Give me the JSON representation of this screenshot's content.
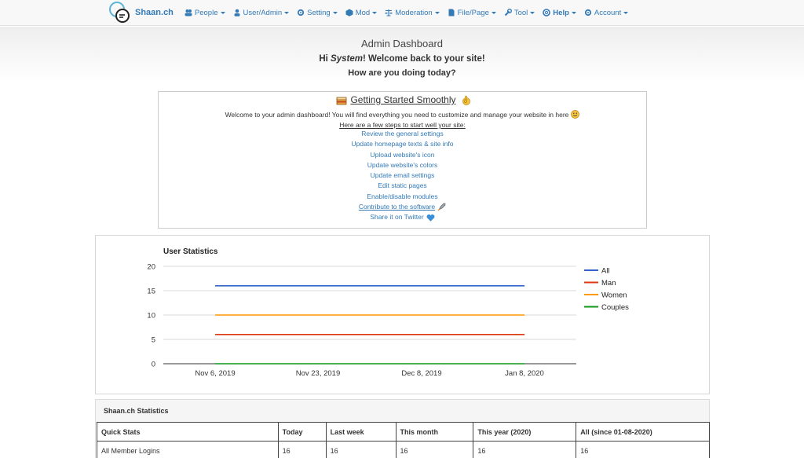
{
  "nav": {
    "brand": "Shaan.ch",
    "items": [
      {
        "label": "People",
        "icon": "users-icon",
        "bold": false
      },
      {
        "label": "User/Admin",
        "icon": "user-icon",
        "bold": false
      },
      {
        "label": "Setting",
        "icon": "gear-icon",
        "bold": false
      },
      {
        "label": "Mod",
        "icon": "cube-icon",
        "bold": false
      },
      {
        "label": "Moderation",
        "icon": "balance-icon",
        "bold": false
      },
      {
        "label": "File/Page",
        "icon": "file-icon",
        "bold": false
      },
      {
        "label": "Tool",
        "icon": "wrench-icon",
        "bold": false
      },
      {
        "label": "Help",
        "icon": "lifebuoy-icon",
        "bold": true
      },
      {
        "label": "Account",
        "icon": "cogs-icon",
        "bold": false
      }
    ]
  },
  "hero": {
    "title": "Admin Dashboard",
    "greeting_prefix": "Hi ",
    "greeting_name": "System",
    "greeting_suffix": "! Welcome back to your site!",
    "question": "How are you doing today?"
  },
  "getting_started": {
    "title": "Getting Started Smoothly",
    "intro": "Welcome to your admin dashboard! You will find everything you need to customize and manage your website in here",
    "steps_title": "Here are a few steps to start well your site:",
    "steps": [
      "Review the general settings",
      "Update homepage texts & site info",
      "Upload website's icon",
      "Update website's colors",
      "Update email settings",
      "Edit static pages",
      "Enable/disable modules",
      "Contribute to the software",
      "Share it on Twitter"
    ]
  },
  "chart_data": {
    "type": "line",
    "title": "User Statistics",
    "xlabel": "",
    "ylabel": "",
    "x": [
      "Nov 6, 2019",
      "Nov 23, 2019",
      "Dec 8, 2019",
      "Jan 8, 2020"
    ],
    "ylim": [
      0,
      20
    ],
    "yticks": [
      0,
      5,
      10,
      15,
      20
    ],
    "grid": true,
    "legend": "right",
    "series": [
      {
        "name": "All",
        "color": "#3366cc",
        "values": [
          16,
          16,
          16,
          16
        ]
      },
      {
        "name": "Man",
        "color": "#dc3912",
        "values": [
          6,
          6,
          6,
          6
        ]
      },
      {
        "name": "Women",
        "color": "#ff9900",
        "values": [
          10,
          10,
          10,
          10
        ]
      },
      {
        "name": "Couples",
        "color": "#109618",
        "values": [
          0,
          0,
          0,
          0
        ]
      }
    ]
  },
  "stats": {
    "title": "Shaan.ch Statistics",
    "headers": [
      "Quick Stats",
      "Today",
      "Last week",
      "This month",
      "This year (2020)",
      "All (since 01-08-2020)"
    ],
    "rows": [
      [
        "All Member Logins",
        "16",
        "16",
        "16",
        "16",
        "16"
      ]
    ]
  }
}
